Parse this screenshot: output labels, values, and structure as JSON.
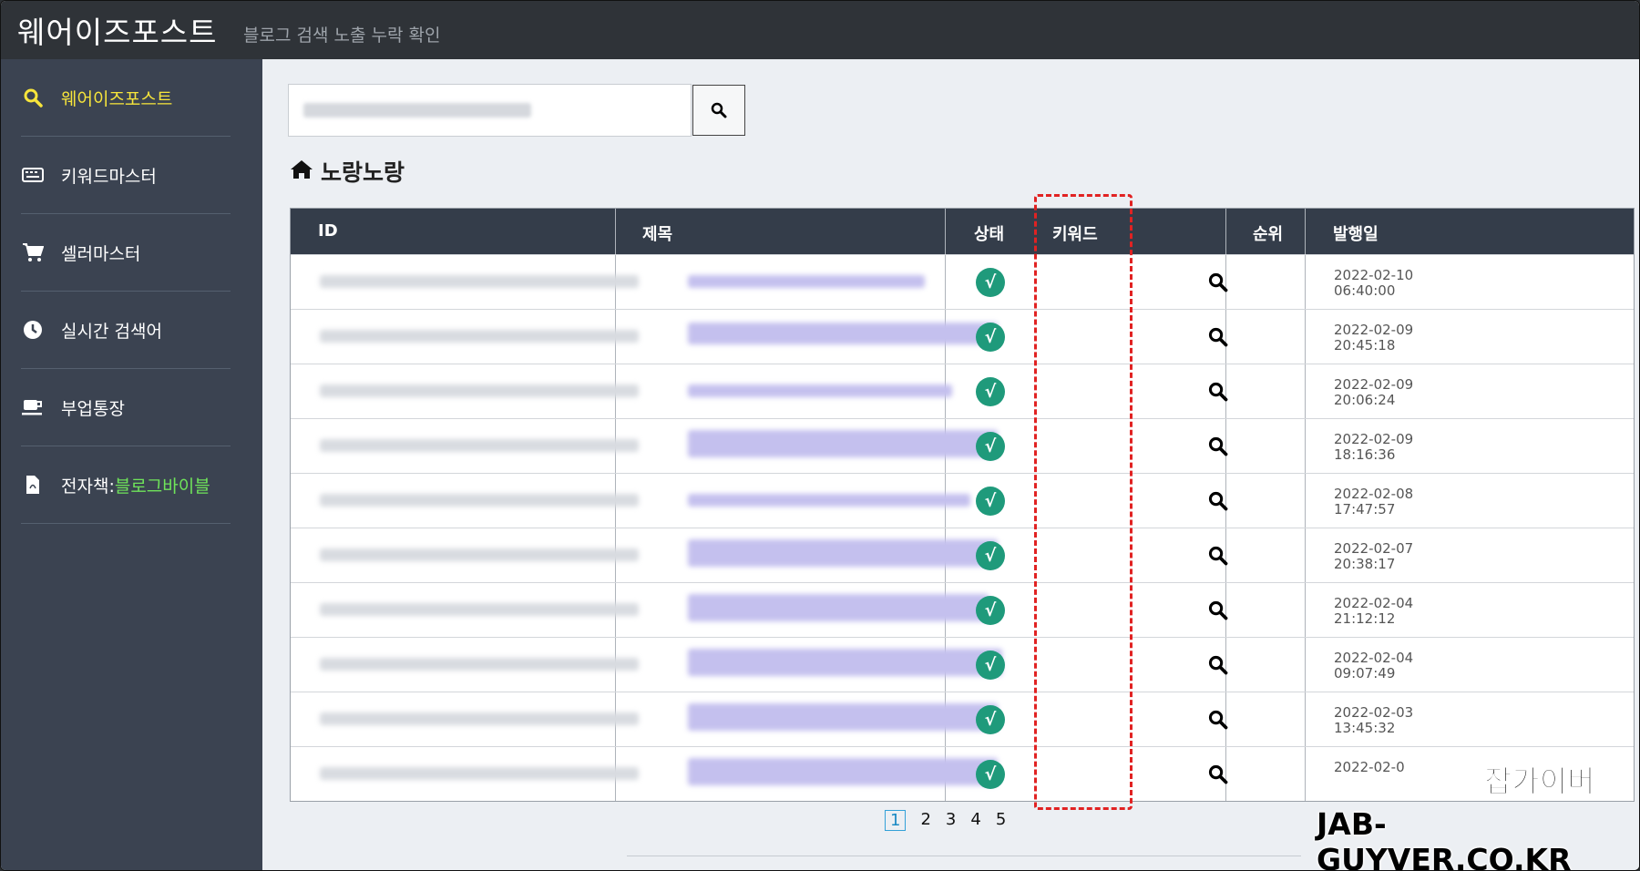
{
  "header": {
    "brand": "웨어이즈포스트",
    "subtitle": "블로그 검색 노출 누락 확인"
  },
  "sidebar": {
    "items": [
      {
        "label": "웨어이즈포스트",
        "icon": "search-icon",
        "active": true
      },
      {
        "label": "키워드마스터",
        "icon": "keyboard-icon"
      },
      {
        "label": "셀러마스터",
        "icon": "cart-icon"
      },
      {
        "label": "실시간 검색어",
        "icon": "clock-icon"
      },
      {
        "label": "부업통장",
        "icon": "coffee-icon"
      },
      {
        "label": "전자책: ",
        "label_highlight": "블로그바이블",
        "icon": "pdf-file-icon"
      }
    ]
  },
  "search": {
    "button_icon": "search-icon"
  },
  "page": {
    "title": "노랑노랑",
    "title_icon": "home-icon"
  },
  "table": {
    "columns": [
      "ID",
      "제목",
      "상태",
      "키워드",
      "순위",
      "발행일"
    ],
    "rows": [
      {
        "status": "√",
        "date": "2022-02-10",
        "time": "06:40:00"
      },
      {
        "status": "√",
        "date": "2022-02-09",
        "time": "20:45:18"
      },
      {
        "status": "√",
        "date": "2022-02-09",
        "time": "20:06:24"
      },
      {
        "status": "√",
        "date": "2022-02-09",
        "time": "18:16:36"
      },
      {
        "status": "√",
        "date": "2022-02-08",
        "time": "17:47:57"
      },
      {
        "status": "√",
        "date": "2022-02-07",
        "time": "20:38:17"
      },
      {
        "status": "√",
        "date": "2022-02-04",
        "time": "21:12:12"
      },
      {
        "status": "√",
        "date": "2022-02-04",
        "time": "09:07:49"
      },
      {
        "status": "√",
        "date": "2022-02-03",
        "time": "13:45:32"
      },
      {
        "status": "√",
        "date": "2022-02-0",
        "time": ""
      }
    ]
  },
  "pagination": {
    "pages": [
      "1",
      "2",
      "3",
      "4",
      "5"
    ],
    "current": "1"
  },
  "watermark": {
    "line1": "잡가이버",
    "line2": "JAB-GUYVER.CO.KR"
  },
  "colors": {
    "topbar": "#2f3338",
    "sidebar": "#3b4351",
    "active_item": "#f7e53b",
    "highlight_green": "#6fe35a",
    "status_ok": "#1f9a7b",
    "annotation_red": "#e12222"
  }
}
